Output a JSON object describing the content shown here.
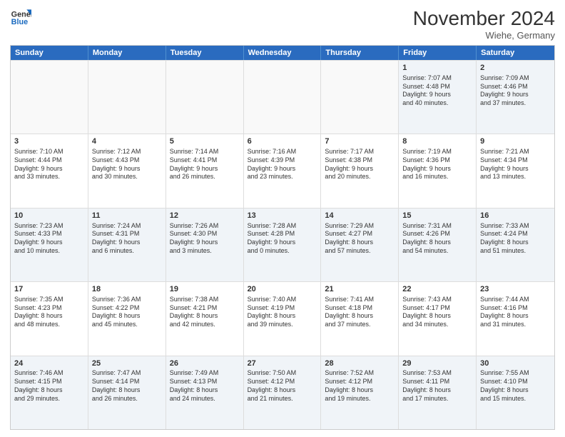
{
  "header": {
    "logo_line1": "General",
    "logo_line2": "Blue",
    "month_title": "November 2024",
    "location": "Wiehe, Germany"
  },
  "days_of_week": [
    "Sunday",
    "Monday",
    "Tuesday",
    "Wednesday",
    "Thursday",
    "Friday",
    "Saturday"
  ],
  "weeks": [
    [
      {
        "day": "",
        "info": ""
      },
      {
        "day": "",
        "info": ""
      },
      {
        "day": "",
        "info": ""
      },
      {
        "day": "",
        "info": ""
      },
      {
        "day": "",
        "info": ""
      },
      {
        "day": "1",
        "info": "Sunrise: 7:07 AM\nSunset: 4:48 PM\nDaylight: 9 hours\nand 40 minutes."
      },
      {
        "day": "2",
        "info": "Sunrise: 7:09 AM\nSunset: 4:46 PM\nDaylight: 9 hours\nand 37 minutes."
      }
    ],
    [
      {
        "day": "3",
        "info": "Sunrise: 7:10 AM\nSunset: 4:44 PM\nDaylight: 9 hours\nand 33 minutes."
      },
      {
        "day": "4",
        "info": "Sunrise: 7:12 AM\nSunset: 4:43 PM\nDaylight: 9 hours\nand 30 minutes."
      },
      {
        "day": "5",
        "info": "Sunrise: 7:14 AM\nSunset: 4:41 PM\nDaylight: 9 hours\nand 26 minutes."
      },
      {
        "day": "6",
        "info": "Sunrise: 7:16 AM\nSunset: 4:39 PM\nDaylight: 9 hours\nand 23 minutes."
      },
      {
        "day": "7",
        "info": "Sunrise: 7:17 AM\nSunset: 4:38 PM\nDaylight: 9 hours\nand 20 minutes."
      },
      {
        "day": "8",
        "info": "Sunrise: 7:19 AM\nSunset: 4:36 PM\nDaylight: 9 hours\nand 16 minutes."
      },
      {
        "day": "9",
        "info": "Sunrise: 7:21 AM\nSunset: 4:34 PM\nDaylight: 9 hours\nand 13 minutes."
      }
    ],
    [
      {
        "day": "10",
        "info": "Sunrise: 7:23 AM\nSunset: 4:33 PM\nDaylight: 9 hours\nand 10 minutes."
      },
      {
        "day": "11",
        "info": "Sunrise: 7:24 AM\nSunset: 4:31 PM\nDaylight: 9 hours\nand 6 minutes."
      },
      {
        "day": "12",
        "info": "Sunrise: 7:26 AM\nSunset: 4:30 PM\nDaylight: 9 hours\nand 3 minutes."
      },
      {
        "day": "13",
        "info": "Sunrise: 7:28 AM\nSunset: 4:28 PM\nDaylight: 9 hours\nand 0 minutes."
      },
      {
        "day": "14",
        "info": "Sunrise: 7:29 AM\nSunset: 4:27 PM\nDaylight: 8 hours\nand 57 minutes."
      },
      {
        "day": "15",
        "info": "Sunrise: 7:31 AM\nSunset: 4:26 PM\nDaylight: 8 hours\nand 54 minutes."
      },
      {
        "day": "16",
        "info": "Sunrise: 7:33 AM\nSunset: 4:24 PM\nDaylight: 8 hours\nand 51 minutes."
      }
    ],
    [
      {
        "day": "17",
        "info": "Sunrise: 7:35 AM\nSunset: 4:23 PM\nDaylight: 8 hours\nand 48 minutes."
      },
      {
        "day": "18",
        "info": "Sunrise: 7:36 AM\nSunset: 4:22 PM\nDaylight: 8 hours\nand 45 minutes."
      },
      {
        "day": "19",
        "info": "Sunrise: 7:38 AM\nSunset: 4:21 PM\nDaylight: 8 hours\nand 42 minutes."
      },
      {
        "day": "20",
        "info": "Sunrise: 7:40 AM\nSunset: 4:19 PM\nDaylight: 8 hours\nand 39 minutes."
      },
      {
        "day": "21",
        "info": "Sunrise: 7:41 AM\nSunset: 4:18 PM\nDaylight: 8 hours\nand 37 minutes."
      },
      {
        "day": "22",
        "info": "Sunrise: 7:43 AM\nSunset: 4:17 PM\nDaylight: 8 hours\nand 34 minutes."
      },
      {
        "day": "23",
        "info": "Sunrise: 7:44 AM\nSunset: 4:16 PM\nDaylight: 8 hours\nand 31 minutes."
      }
    ],
    [
      {
        "day": "24",
        "info": "Sunrise: 7:46 AM\nSunset: 4:15 PM\nDaylight: 8 hours\nand 29 minutes."
      },
      {
        "day": "25",
        "info": "Sunrise: 7:47 AM\nSunset: 4:14 PM\nDaylight: 8 hours\nand 26 minutes."
      },
      {
        "day": "26",
        "info": "Sunrise: 7:49 AM\nSunset: 4:13 PM\nDaylight: 8 hours\nand 24 minutes."
      },
      {
        "day": "27",
        "info": "Sunrise: 7:50 AM\nSunset: 4:12 PM\nDaylight: 8 hours\nand 21 minutes."
      },
      {
        "day": "28",
        "info": "Sunrise: 7:52 AM\nSunset: 4:12 PM\nDaylight: 8 hours\nand 19 minutes."
      },
      {
        "day": "29",
        "info": "Sunrise: 7:53 AM\nSunset: 4:11 PM\nDaylight: 8 hours\nand 17 minutes."
      },
      {
        "day": "30",
        "info": "Sunrise: 7:55 AM\nSunset: 4:10 PM\nDaylight: 8 hours\nand 15 minutes."
      }
    ]
  ]
}
